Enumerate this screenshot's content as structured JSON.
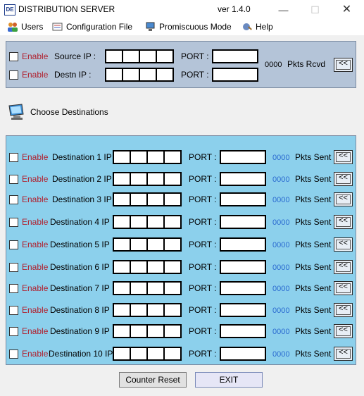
{
  "window": {
    "icon_text": "DE",
    "title": "DISTRIBUTION SERVER",
    "version": "ver 1.4.0",
    "minimize": "—",
    "maximize": "☐",
    "close": "✕"
  },
  "menu": {
    "items": [
      {
        "label": "Users",
        "icon": "users-icon"
      },
      {
        "label": "Configuration File",
        "icon": "config-file-icon"
      },
      {
        "label": "Promiscuous Mode",
        "icon": "promiscuous-icon"
      },
      {
        "label": "Help",
        "icon": "help-icon"
      }
    ]
  },
  "source": {
    "enable_label": "Enable",
    "source_ip_label": "Source IP :",
    "destn_ip_label": "Destn IP :",
    "port_label": "PORT :",
    "count": "0000",
    "pkts_label": "Pkts Rcvd",
    "arrow_label": "<<"
  },
  "choose_destinations": "Choose Destinations",
  "destinations": {
    "enable_label": "Enable",
    "port_label": "PORT :",
    "pkts_label": "Pkts Sent",
    "arrow_label": "<<",
    "rows": [
      {
        "label": "Destination 1 IP :",
        "count": "0000"
      },
      {
        "label": "Destination 2 IP :",
        "count": "0000"
      },
      {
        "label": "Destination 3 IP :",
        "count": "0000"
      },
      {
        "label": "Destination 4 IP :",
        "count": "0000"
      },
      {
        "label": "Destination 5 IP :",
        "count": "0000"
      },
      {
        "label": "Destination 6 IP :",
        "count": "0000"
      },
      {
        "label": "Destination 7 IP :",
        "count": "0000"
      },
      {
        "label": "Destination 8 IP :",
        "count": "0000"
      },
      {
        "label": "Destination 9 IP :",
        "count": "0000"
      },
      {
        "label": "Destination 10 IP :",
        "count": "0000"
      }
    ]
  },
  "buttons": {
    "counter_reset": "Counter Reset",
    "exit": "EXIT"
  },
  "colors": {
    "source_panel": "#b4c4d8",
    "destination_panel": "#8cd0ec",
    "enable_text": "#b0202e",
    "counter_text": "#2a6ad0"
  }
}
